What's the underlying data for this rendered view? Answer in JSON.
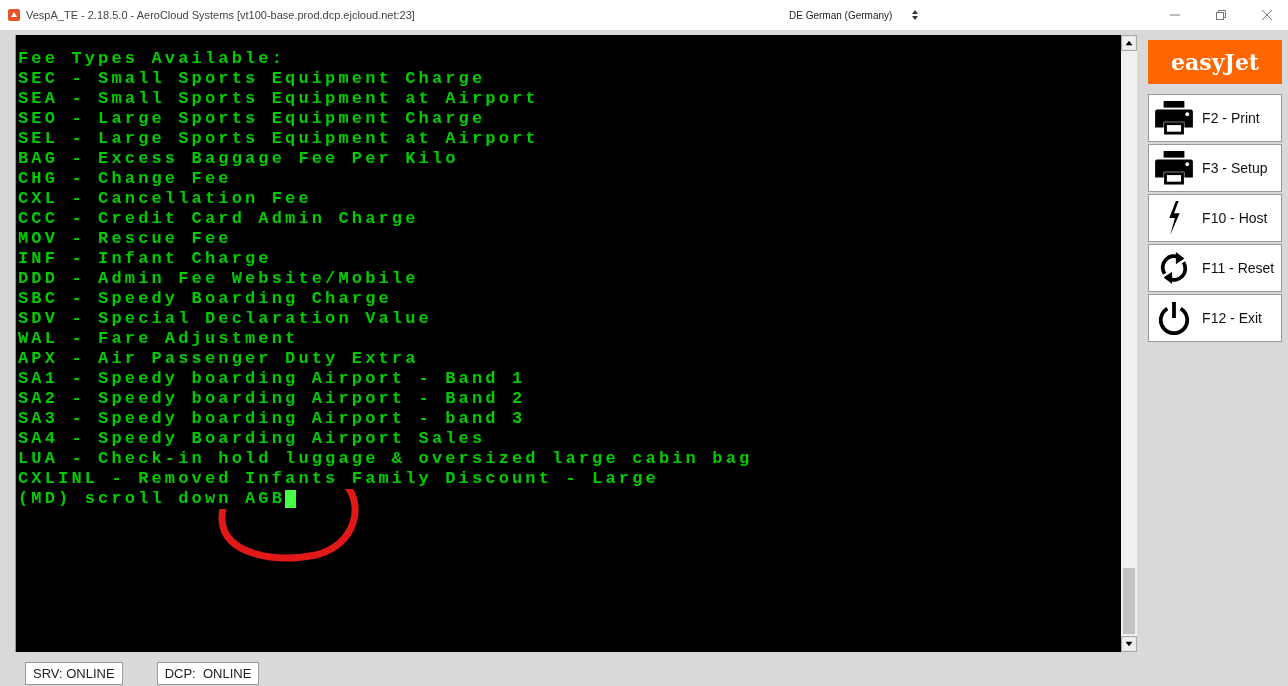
{
  "window": {
    "title": "VespA_TE - 2.18.5.0 - AeroCloud Systems [vt100-base.prod.dcp.ejcloud.net:23]",
    "keyboard_layout": "DE German (Germany)"
  },
  "terminal": {
    "lines": [
      "Fee Types Available:",
      "SEC - Small Sports Equipment Charge",
      "SEA - Small Sports Equipment at Airport",
      "SEO - Large Sports Equipment Charge",
      "SEL - Large Sports Equipment at Airport",
      "BAG - Excess Baggage Fee Per Kilo",
      "CHG - Change Fee",
      "CXL - Cancellation Fee",
      "CCC - Credit Card Admin Charge",
      "MOV - Rescue Fee",
      "INF - Infant Charge",
      "DDD - Admin Fee Website/Mobile",
      "SBC - Speedy Boarding Charge",
      "SDV - Special Declaration Value",
      "WAL - Fare Adjustment",
      "APX - Air Passenger Duty Extra",
      "SA1 - Speedy boarding Airport - Band 1",
      "SA2 - Speedy boarding Airport - Band 2",
      "SA3 - Speedy boarding Airport - band 3",
      "SA4 - Speedy Boarding Airport Sales",
      "LUA - Check-in hold luggage & oversized large cabin bag",
      "CXLINL - Removed Infants Family Discount - Large",
      "(MD) scroll down AGB"
    ]
  },
  "logo": {
    "text": "easyJet"
  },
  "function_keys": [
    {
      "kind": "printer",
      "label": "F2 - Print"
    },
    {
      "kind": "printer",
      "label": "F3 - Setup"
    },
    {
      "kind": "bolt",
      "label": "F10 - Host"
    },
    {
      "kind": "refresh",
      "label": "F11 - Reset"
    },
    {
      "kind": "power",
      "label": "F12 - Exit"
    }
  ],
  "status_bar": [
    {
      "label": "SRV: ONLINE"
    },
    {
      "label": "DCP:  ONLINE"
    }
  ]
}
